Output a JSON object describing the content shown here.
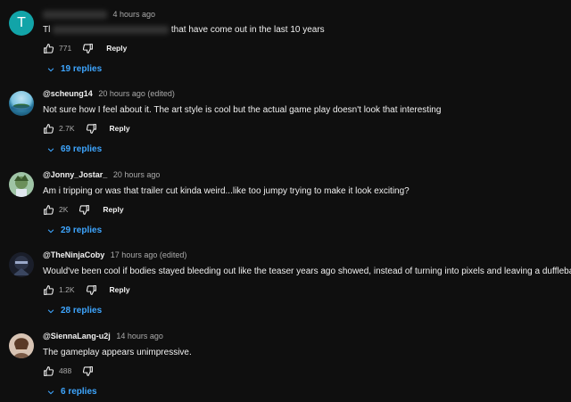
{
  "comments": [
    {
      "avatar_letter": "T",
      "avatar_color": "#12a4a8",
      "author": "",
      "time": "4 hours ago",
      "text_start": "Tl",
      "text_end": "that have come out in the last 10 years",
      "likes": "771",
      "reply_label": "Reply",
      "replies_label": "19 replies"
    },
    {
      "author": "@scheung14",
      "time": "20 hours ago (edited)",
      "text": "Not sure how I feel about it. The art style is cool but the actual game play doesn't look that interesting",
      "likes": "2.7K",
      "reply_label": "Reply",
      "replies_label": "69 replies"
    },
    {
      "author": "@Jonny_Jostar_",
      "time": "20 hours ago",
      "text": "Am i tripping or was that trailer cut kinda weird...like too jumpy trying to make it look exciting?",
      "likes": "2K",
      "reply_label": "Reply",
      "replies_label": "29 replies"
    },
    {
      "author": "@TheNinjaCoby",
      "time": "17 hours ago (edited)",
      "text": "Would've been cool if bodies stayed bleeding out like the teaser years ago showed, instead of turning into pixels and leaving a dufflebag.",
      "likes": "1.2K",
      "reply_label": "Reply",
      "replies_label": "28 replies"
    },
    {
      "author": "@SiennaLang-u2j",
      "time": "14 hours ago",
      "text": "The gameplay appears unimpressive.",
      "likes": "488",
      "reply_label": "",
      "replies_label": "6 replies"
    }
  ]
}
